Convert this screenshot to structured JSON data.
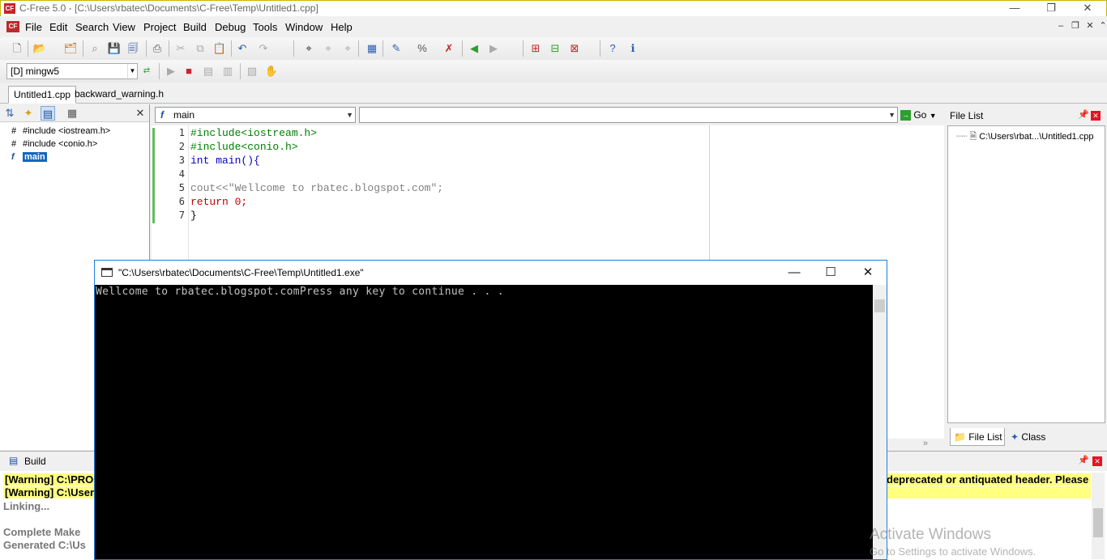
{
  "window": {
    "title": "C-Free 5.0 - [C:\\Users\\rbatec\\Documents\\C-Free\\Temp\\Untitled1.cpp]",
    "app_icon_text": "CF"
  },
  "menu": [
    "File",
    "Edit",
    "Search",
    "View",
    "Project",
    "Build",
    "Debug",
    "Tools",
    "Window",
    "Help"
  ],
  "toolbar": {
    "compiler": "[D] mingw5"
  },
  "tabs": [
    "Untitled1.cpp",
    "backward_warning.h"
  ],
  "class_tree": [
    {
      "icon": "#",
      "label": "#include <iostream.h>"
    },
    {
      "icon": "#",
      "label": "#include <conio.h>"
    },
    {
      "icon": "f",
      "label": "main"
    }
  ],
  "editor": {
    "function_combo": "main",
    "symbol_combo": "",
    "go_label": "Go",
    "line_numbers": [
      "1",
      "2",
      "3",
      "4",
      "5",
      "6",
      "7"
    ],
    "lines": [
      "#include<iostream.h>",
      "#include<conio.h>",
      "int main(){",
      "",
      "cout<<\"Wellcome to rbatec.blogspot.com\";",
      "return 0;",
      "}"
    ]
  },
  "file_list": {
    "title": "File List",
    "item": "C:\\Users\\rbat...\\Untitled1.cpp",
    "tab_files": "File List",
    "tab_class": "Class"
  },
  "build": {
    "title": "Build",
    "lines": [
      "[Warning] C:\\PROG",
      "[Warning] C:\\Users\\",
      "Linking...",
      "",
      "Complete Make",
      "Generated C:\\Us"
    ],
    "warning_tail": "deprecated or antiquated header. Please co"
  },
  "console": {
    "title": "\"C:\\Users\\rbatec\\Documents\\C-Free\\Temp\\Untitled1.exe\"",
    "output": "Wellcome to rbatec.blogspot.comPress any key to continue . . ."
  },
  "watermark": {
    "line1": "Activate Windows",
    "line2": "Go to Settings to activate Windows."
  }
}
